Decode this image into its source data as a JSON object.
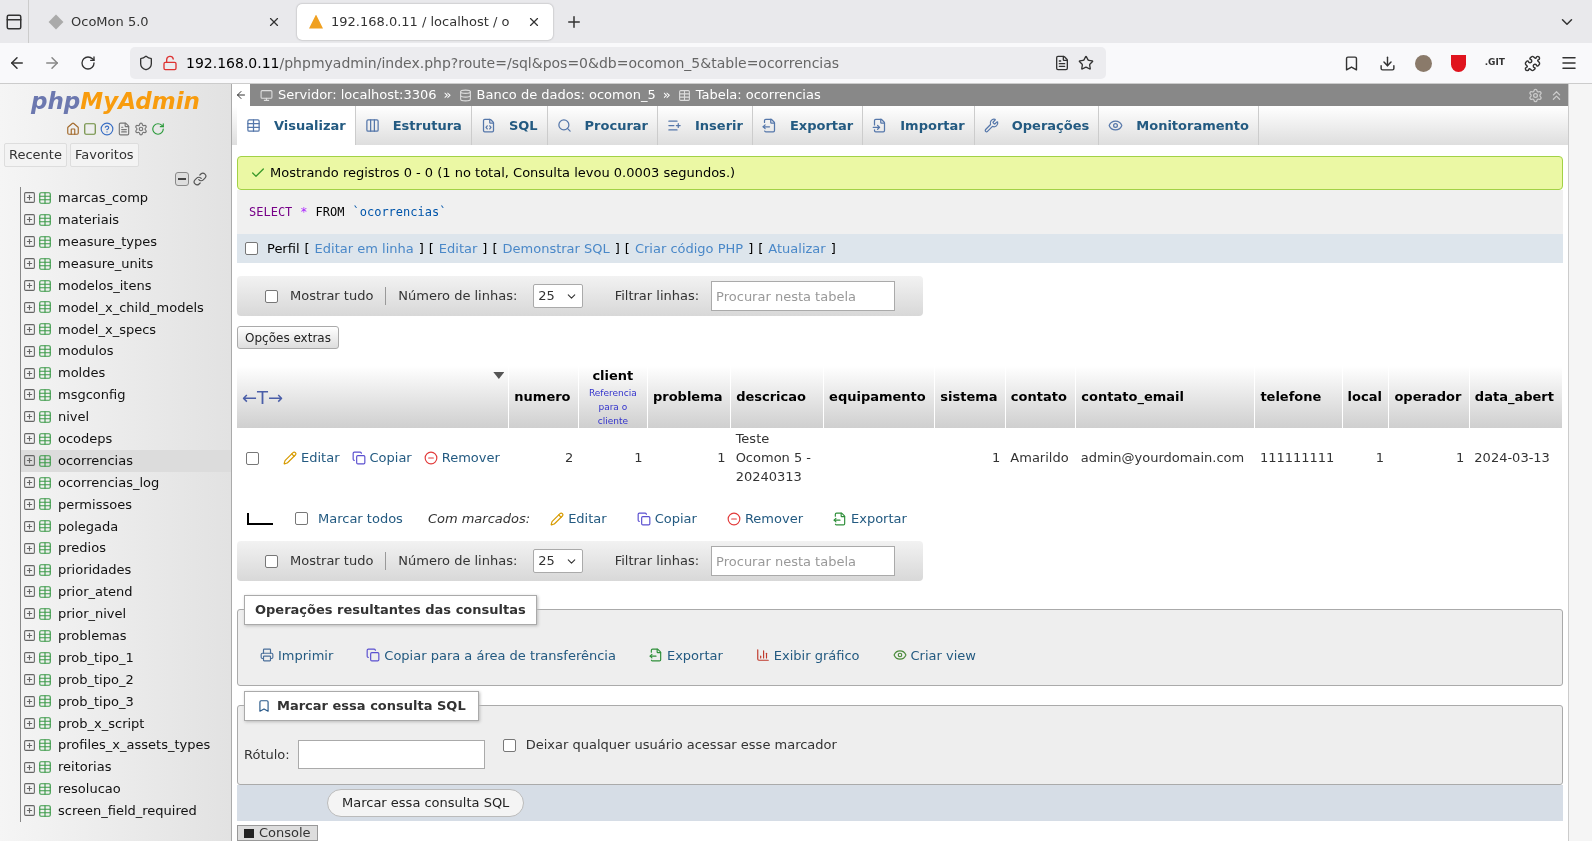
{
  "browser": {
    "tabs": [
      {
        "title": "OcoMon 5.0",
        "selected": false
      },
      {
        "title": "192.168.0.11 / localhost / o",
        "selected": true
      }
    ],
    "url": {
      "host": "192.168.0.11",
      "path": "/phpmyadmin/index.php?route=/sql&pos=0&db=ocomon_5&table=ocorrencias"
    },
    "extension_label": ".GIT"
  },
  "sidebar": {
    "logo": {
      "php": "php",
      "myadmin": "MyAdmin"
    },
    "buttons": [
      "Recente",
      "Favoritos"
    ],
    "tables": [
      {
        "name": "marcas_comp",
        "selected": false
      },
      {
        "name": "materiais",
        "selected": false
      },
      {
        "name": "measure_types",
        "selected": false
      },
      {
        "name": "measure_units",
        "selected": false
      },
      {
        "name": "modelos_itens",
        "selected": false
      },
      {
        "name": "model_x_child_models",
        "selected": false
      },
      {
        "name": "model_x_specs",
        "selected": false
      },
      {
        "name": "modulos",
        "selected": false
      },
      {
        "name": "moldes",
        "selected": false
      },
      {
        "name": "msgconfig",
        "selected": false
      },
      {
        "name": "nivel",
        "selected": false
      },
      {
        "name": "ocodeps",
        "selected": false
      },
      {
        "name": "ocorrencias",
        "selected": true
      },
      {
        "name": "ocorrencias_log",
        "selected": false
      },
      {
        "name": "permissoes",
        "selected": false
      },
      {
        "name": "polegada",
        "selected": false
      },
      {
        "name": "predios",
        "selected": false
      },
      {
        "name": "prioridades",
        "selected": false
      },
      {
        "name": "prior_atend",
        "selected": false
      },
      {
        "name": "prior_nivel",
        "selected": false
      },
      {
        "name": "problemas",
        "selected": false
      },
      {
        "name": "prob_tipo_1",
        "selected": false
      },
      {
        "name": "prob_tipo_2",
        "selected": false
      },
      {
        "name": "prob_tipo_3",
        "selected": false
      },
      {
        "name": "prob_x_script",
        "selected": false
      },
      {
        "name": "profiles_x_assets_types",
        "selected": false
      },
      {
        "name": "reitorias",
        "selected": false
      },
      {
        "name": "resolucao",
        "selected": false
      },
      {
        "name": "screen_field_required",
        "selected": false
      }
    ]
  },
  "breadcrumb": {
    "separator": "»",
    "items": [
      {
        "label": "Servidor: localhost:3306",
        "kind": "server"
      },
      {
        "label": "Banco de dados: ocomon_5",
        "kind": "database"
      },
      {
        "label": "Tabela: ocorrencias",
        "kind": "table"
      }
    ]
  },
  "tabs": [
    {
      "label": "Visualizar",
      "kind": "browse",
      "selected": true
    },
    {
      "label": "Estrutura",
      "kind": "structure",
      "selected": false
    },
    {
      "label": "SQL",
      "kind": "sql",
      "selected": false
    },
    {
      "label": "Procurar",
      "kind": "search",
      "selected": false
    },
    {
      "label": "Inserir",
      "kind": "insert",
      "selected": false
    },
    {
      "label": "Exportar",
      "kind": "export",
      "selected": false
    },
    {
      "label": "Importar",
      "kind": "import",
      "selected": false
    },
    {
      "label": "Operações",
      "kind": "operations",
      "selected": false
    },
    {
      "label": "Monitoramento",
      "kind": "tracking",
      "selected": false
    }
  ],
  "message": "Mostrando registros 0 - 0 (1 no total, Consulta levou 0.0003 segundos.)",
  "sql": [
    {
      "text": "SELECT",
      "kind": "keyword"
    },
    {
      "text": "*",
      "kind": "operator"
    },
    {
      "text": "FROM",
      "kind": "plain"
    },
    {
      "text": "`ocorrencias`",
      "kind": "identifier"
    }
  ],
  "profile": {
    "label": "Perfil",
    "checked": false,
    "open": "[",
    "close": "]",
    "links": [
      "Editar em linha",
      "Editar",
      "Demonstrar SQL",
      "Criar código PHP",
      "Atualizar"
    ]
  },
  "navigation": [
    {
      "show_all": "Mostrar tudo",
      "checked": false,
      "rows_label": "Número de linhas:",
      "rows_value": "25",
      "filter_label": "Filtrar linhas:",
      "filter_placeholder": "Procurar nesta tabela"
    },
    {
      "show_all": "Mostrar tudo",
      "checked": false,
      "rows_label": "Número de linhas:",
      "rows_value": "25",
      "filter_label": "Filtrar linhas:",
      "filter_placeholder": "Procurar nesta tabela"
    }
  ],
  "extra_options": "Opções extras",
  "table": {
    "toggle": "←T→",
    "columns": [
      {
        "label": "numero",
        "kind": "number"
      },
      {
        "label": "client",
        "sublabel": "Referencia para o cliente",
        "kind": "number"
      },
      {
        "label": "problema",
        "kind": "number"
      },
      {
        "label": "descricao",
        "kind": "text"
      },
      {
        "label": "equipamento",
        "kind": "text"
      },
      {
        "label": "sistema",
        "kind": "number"
      },
      {
        "label": "contato",
        "kind": "text"
      },
      {
        "label": "contato_email",
        "kind": "text"
      },
      {
        "label": "telefone",
        "kind": "text"
      },
      {
        "label": "local",
        "kind": "number"
      },
      {
        "label": "operador",
        "kind": "number"
      },
      {
        "label": "data_abert",
        "kind": "text"
      }
    ],
    "rows": [
      {
        "checked": false,
        "actions": [
          {
            "label": "Editar",
            "kind": "edit"
          },
          {
            "label": "Copiar",
            "kind": "copy"
          },
          {
            "label": "Remover",
            "kind": "delete"
          }
        ],
        "cells": [
          "2",
          "1",
          "1",
          "Teste Ocomon 5 - 20240313",
          null,
          "1",
          "Amarildo",
          "admin@yourdomain.com",
          "111111111",
          "1",
          "1",
          "2024-03-13"
        ]
      }
    ]
  },
  "bulk": {
    "check_all": "Marcar todos",
    "checked": false,
    "with_selected": "Com marcados:",
    "actions": [
      {
        "label": "Editar",
        "kind": "edit"
      },
      {
        "label": "Copiar",
        "kind": "copy"
      },
      {
        "label": "Remover",
        "kind": "delete"
      },
      {
        "label": "Exportar",
        "kind": "export"
      }
    ]
  },
  "query_operations": {
    "legend": "Operações resultantes das consultas",
    "actions": [
      {
        "label": "Imprimir",
        "kind": "print"
      },
      {
        "label": "Copiar para a área de transferência",
        "kind": "copy"
      },
      {
        "label": "Exportar",
        "kind": "export"
      },
      {
        "label": "Exibir gráfico",
        "kind": "chart"
      },
      {
        "label": "Criar view",
        "kind": "view"
      }
    ]
  },
  "bookmark": {
    "legend": "Marcar essa consulta SQL",
    "label_field": "Rótulo:",
    "share": "Deixar qualquer usuário acessar esse marcador",
    "shared": false,
    "submit": "Marcar essa consulta SQL"
  },
  "console": "Console"
}
